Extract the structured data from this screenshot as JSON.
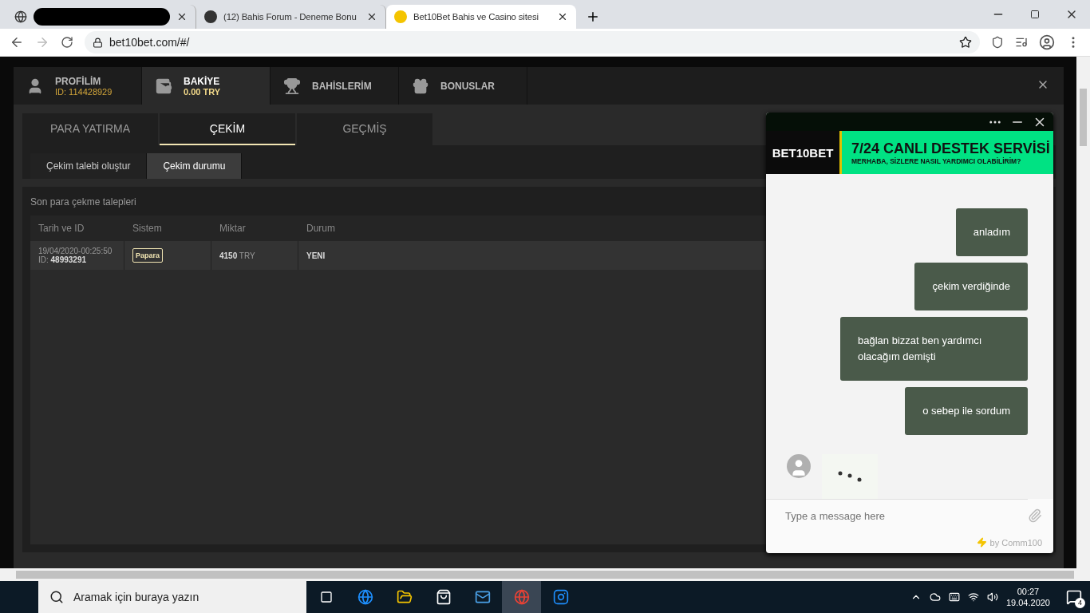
{
  "browser": {
    "tabs": [
      {
        "kind": "redacted",
        "selected": false
      },
      {
        "kind": "page",
        "title": "(12) Bahis Forum - Deneme Bonu",
        "selected": false
      },
      {
        "kind": "page",
        "title": "Bet10Bet Bahis ve Casino sitesi",
        "selected": true
      }
    ],
    "address": "bet10bet.com/#/"
  },
  "account_nav": [
    {
      "kind": "profile",
      "label": "PROFİLİM",
      "sub": "ID: 114428929",
      "selected": false
    },
    {
      "kind": "wallet",
      "label": "BAKİYE",
      "sub": "0.00 TRY",
      "selected": true
    },
    {
      "kind": "bets",
      "label": "BAHİSLERİM",
      "selected": false
    },
    {
      "kind": "bonus",
      "label": "BONUSLAR",
      "selected": false
    }
  ],
  "tabs": [
    {
      "label": "PARA YATIRMA",
      "selected": false
    },
    {
      "label": "ÇEKİM",
      "selected": true
    },
    {
      "label": "GEÇMİŞ",
      "selected": false
    }
  ],
  "subtabs": [
    {
      "label": "Çekim talebi oluştur",
      "selected": false
    },
    {
      "label": "Çekim durumu",
      "selected": true
    }
  ],
  "section_title": "Son para çekme talepleri",
  "table": {
    "columns": [
      "Tarih ve ID",
      "Sistem",
      "Miktar",
      "Durum"
    ],
    "rows": [
      {
        "date": "19/04/2020-00:25:50",
        "id_label": "ID:",
        "id": "48993291",
        "system": "Papara",
        "amount": "4150",
        "currency": "TRY",
        "status": "YENI"
      }
    ]
  },
  "chat": {
    "logo": "BET10BET",
    "title": "7/24 CANLI DESTEK SERVİSİ",
    "subtitle": "MERHABA, SİZLERE NASIL YARDIMCI OLABİLİRİM?",
    "messages": [
      {
        "kind": "sent",
        "text": "anladım"
      },
      {
        "kind": "sent",
        "text": "çekim verdiğinde"
      },
      {
        "kind": "sent",
        "text": "bağlan bizzat ben yardımcı olacağım demişti"
      },
      {
        "kind": "sent",
        "text": "o sebep ile sordum"
      }
    ],
    "typing": true,
    "placeholder": "Type a message here",
    "powered_by": "by Comm100"
  },
  "taskbar": {
    "search_placeholder": "Aramak için buraya yazın",
    "time": "00:27",
    "date": "19.04.2020",
    "notifications": "4"
  }
}
